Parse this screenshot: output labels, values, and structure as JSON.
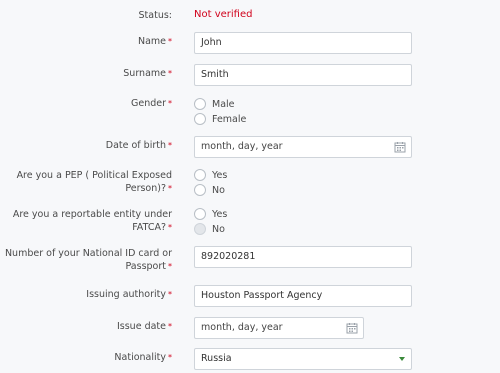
{
  "status": {
    "label": "Status:",
    "value": "Not verified"
  },
  "name": {
    "label": "Name",
    "value": "John"
  },
  "surname": {
    "label": "Surname",
    "value": "Smith"
  },
  "gender": {
    "label": "Gender",
    "options": [
      "Male",
      "Female"
    ]
  },
  "dob": {
    "label": "Date of birth",
    "placeholder": "month, day, year"
  },
  "pep": {
    "label_line1": "Are you a PEP ( Political Exposed",
    "label_line2": "Person)?",
    "options": [
      "Yes",
      "No"
    ]
  },
  "fatca": {
    "label_line1": "Are you a reportable entity under",
    "label_line2": "FATCA?",
    "options": [
      "Yes",
      "No"
    ]
  },
  "national_id": {
    "label_line1": "Number of your National ID card or",
    "label_line2": "Passport",
    "value": "892020281"
  },
  "authority": {
    "label": "Issuing authority",
    "value": "Houston Passport Agency"
  },
  "issue_date": {
    "label": "Issue date",
    "placeholder": "month, day, year"
  },
  "nationality": {
    "label": "Nationality",
    "value": "Russia"
  },
  "required_mark": "*",
  "colors": {
    "error": "#d0021b",
    "border": "#cfd4da",
    "background": "#f7f8fa"
  },
  "icons": {
    "date": "calendar-icon",
    "select": "chevron-down-icon"
  }
}
